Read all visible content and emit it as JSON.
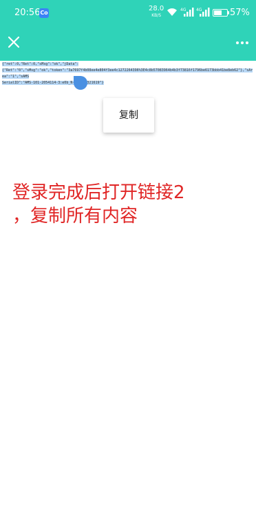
{
  "status_bar": {
    "time": "20:56",
    "app_badge": "Co",
    "net_speed": "28.0",
    "net_speed_unit": "KB/S",
    "signal_1": "4G",
    "signal_2": "4G",
    "battery": "57%",
    "battery_level_percent": 57
  },
  "app_bar": {
    "close_icon": "close-icon",
    "more_icon": "more-horizontal-icon",
    "color": "#2fd3b8"
  },
  "content": {
    "line_1": "{\"ret\":0,\"Ret\":0,\"sMsg\":\"ok\",\"jData\":",
    "line_2": "{\"Ret\":\"0\",\"sMsg\":\"ok\",\"token\":\"3a7697f4b08ee4e804f3ee4c1272264396%3E4c8b57083964b4b3f73816f1796be6173bbb41be8eb62\"},\"sArea\":\"1\",\"sAMS",
    "line_3": "SerialID\":\"AMS-101-2054114-3:e0b_N-66155-321619\"}"
  },
  "popup": {
    "copy_label": "复制"
  },
  "annotation": {
    "line_1": "登录完成后打开链接2",
    "line_2": "，复制所有内容"
  }
}
